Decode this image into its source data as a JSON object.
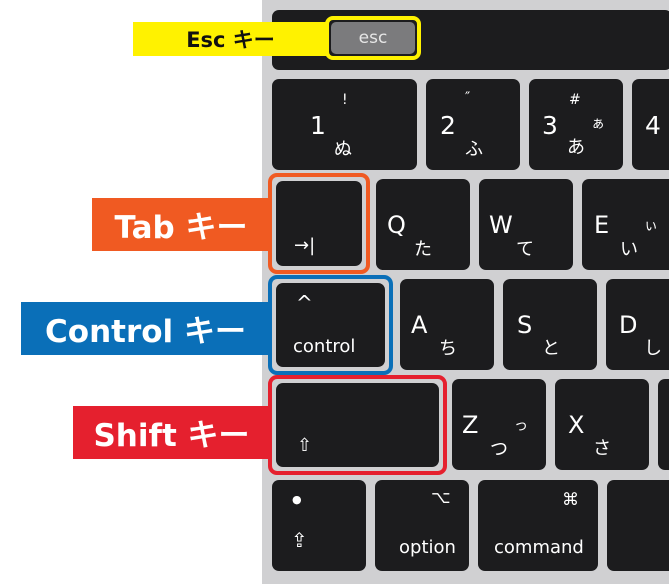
{
  "callouts": {
    "esc": {
      "text": "Esc キー",
      "bg": "#fff200",
      "fg": "#111111"
    },
    "tab": {
      "text": "Tab キー",
      "bg": "#f05a22"
    },
    "control": {
      "text": "Control キー",
      "bg": "#0a6fb8"
    },
    "shift": {
      "text": "Shift キー",
      "bg": "#e5202e"
    }
  },
  "keys": {
    "esc": "esc",
    "k1": {
      "main": "1",
      "shift": "!",
      "kana": "ぬ"
    },
    "k2": {
      "main": "2",
      "shift": "″",
      "kana": "ふ"
    },
    "k3": {
      "main": "3",
      "shift": "#",
      "kana": "あ",
      "kana_small": "ぁ"
    },
    "k4": {
      "main": "4"
    },
    "tab": "→|",
    "q": {
      "main": "Q",
      "kana": "た"
    },
    "w": {
      "main": "W",
      "kana": "て"
    },
    "e": {
      "main": "E",
      "kana": "い",
      "kana_small": "ぃ"
    },
    "control": {
      "symbol": "^",
      "label": "control"
    },
    "a": {
      "main": "A",
      "kana": "ち"
    },
    "s": {
      "main": "S",
      "kana": "と"
    },
    "d": {
      "main": "D",
      "kana": "し"
    },
    "shift": "⇧",
    "z": {
      "main": "Z",
      "kana": "つ",
      "kana_small": "っ"
    },
    "x": {
      "main": "X",
      "kana": "さ"
    },
    "fn": {
      "dot": "●",
      "symbol": "⇪"
    },
    "option": {
      "symbol": "⌥",
      "label": "option"
    },
    "command": {
      "symbol": "⌘",
      "label": "command"
    }
  }
}
